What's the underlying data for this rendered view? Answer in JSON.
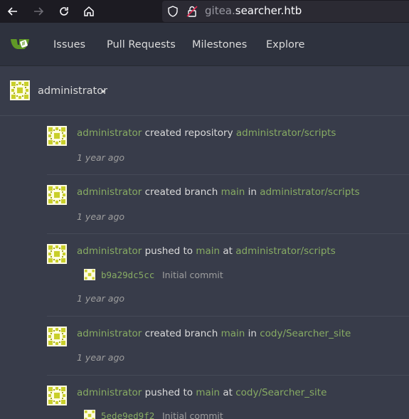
{
  "browser": {
    "url_prefix": "gitea.",
    "url_domain": "searcher.htb",
    "back_icon": "arrow-left-icon",
    "forward_icon": "arrow-right-icon",
    "reload_icon": "reload-icon",
    "home_icon": "home-icon"
  },
  "nav": {
    "issues": "Issues",
    "pull_requests": "Pull Requests",
    "milestones": "Milestones",
    "explore": "Explore"
  },
  "context": {
    "user": "administrator"
  },
  "feed": [
    {
      "actor": "administrator",
      "action": "created repository",
      "ref": "",
      "prep": "",
      "repo": "administrator/scripts",
      "time": "1 year ago"
    },
    {
      "actor": "administrator",
      "action": "created branch",
      "ref": "main",
      "prep": "in",
      "repo": "administrator/scripts",
      "time": "1 year ago"
    },
    {
      "actor": "administrator",
      "action": "pushed to",
      "ref": "main",
      "prep": "at",
      "repo": "administrator/scripts",
      "commit_sha": "b9a29dc5cc",
      "commit_msg": "Initial commit",
      "time": "1 year ago"
    },
    {
      "actor": "administrator",
      "action": "created branch",
      "ref": "main",
      "prep": "in",
      "repo": "cody/Searcher_site",
      "time": "1 year ago"
    },
    {
      "actor": "administrator",
      "action": "pushed to",
      "ref": "main",
      "prep": "at",
      "repo": "cody/Searcher_site",
      "commit_sha": "5ede9ed9f2",
      "commit_msg": "Initial commit"
    }
  ],
  "colors": {
    "link": "#87ab63",
    "background": "#383c4a",
    "header": "#2e323e"
  }
}
